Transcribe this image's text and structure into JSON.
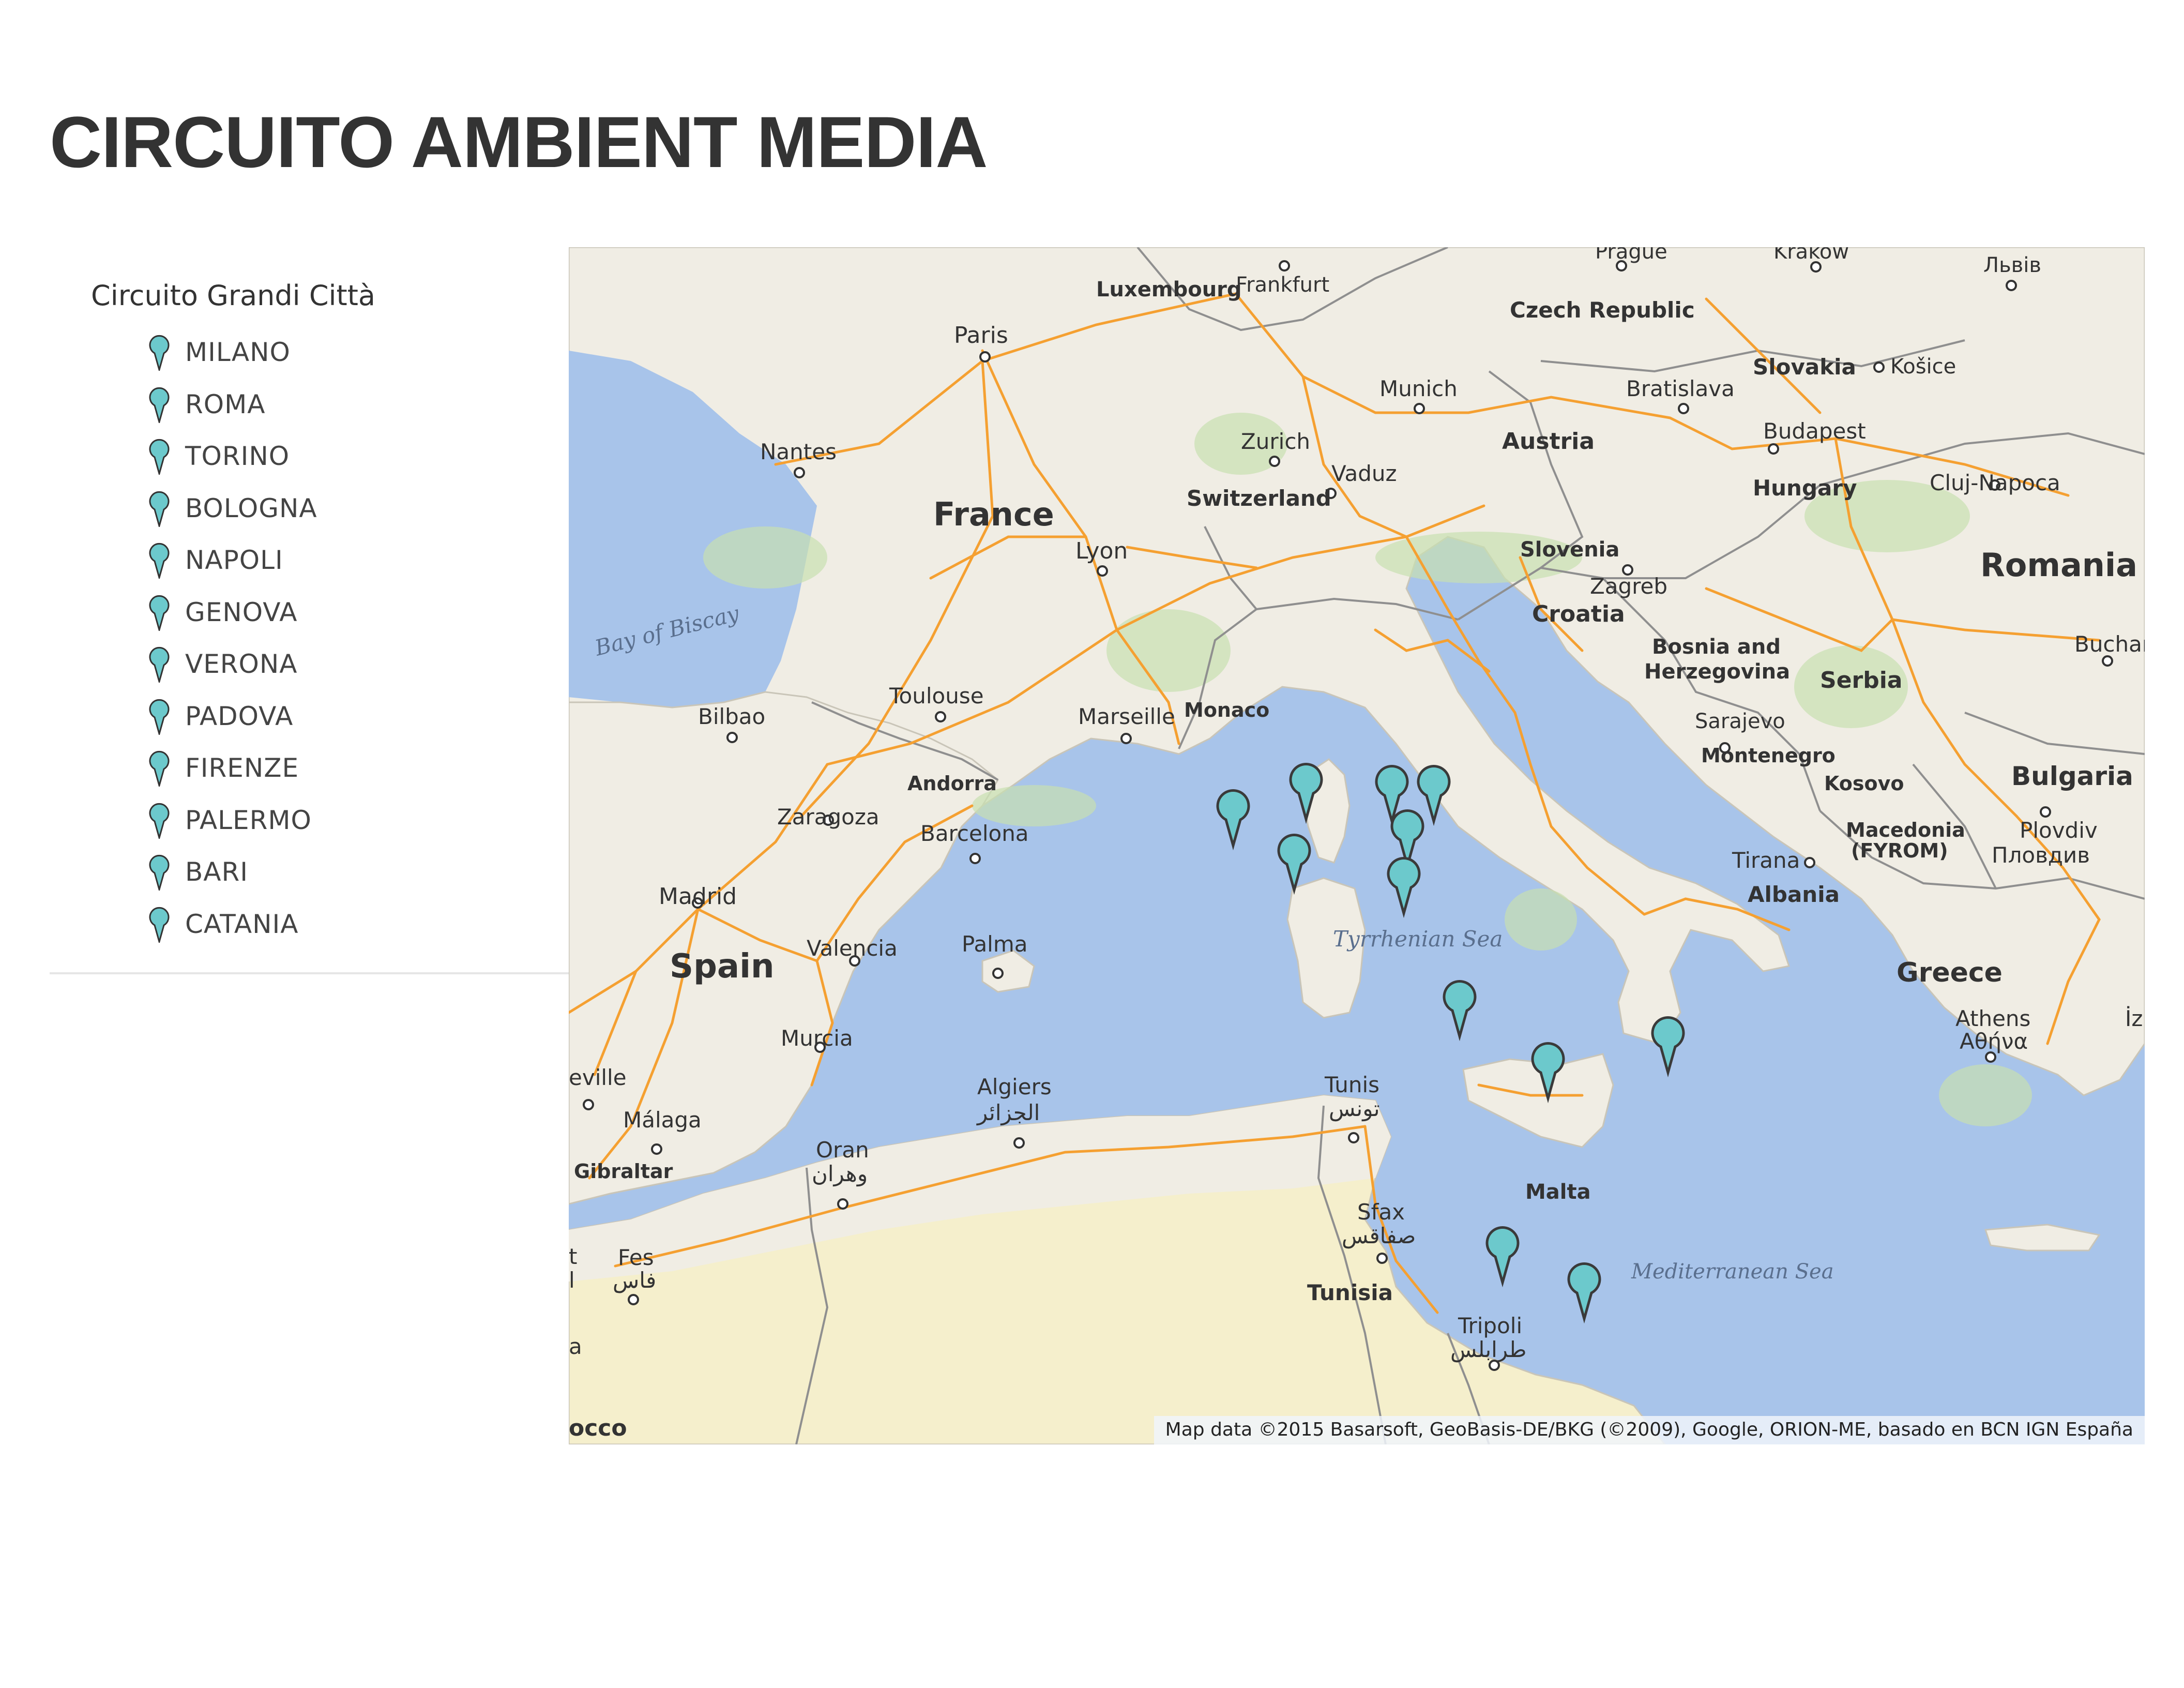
{
  "page": {
    "title": "CIRCUITO AMBIENT MEDIA"
  },
  "legend": {
    "title": "Circuito Grandi Città",
    "items": [
      {
        "label": "MILANO"
      },
      {
        "label": "ROMA"
      },
      {
        "label": "TORINO"
      },
      {
        "label": "BOLOGNA"
      },
      {
        "label": "NAPOLI"
      },
      {
        "label": "GENOVA"
      },
      {
        "label": "VERONA"
      },
      {
        "label": "PADOVA"
      },
      {
        "label": "FIRENZE"
      },
      {
        "label": "PALERMO"
      },
      {
        "label": "BARI"
      },
      {
        "label": "CATANIA"
      }
    ]
  },
  "map": {
    "attribution": "Map data ©2015 Basarsoft, GeoBasis-DE/BKG (©2009), Google, ORION-ME, basado en BCN IGN España",
    "colors": {
      "sea": "#a8c4ea",
      "land": "#f0ede4",
      "road": "#f5a031",
      "pin": "#6cc9cc",
      "pin_border": "#3a3a3a",
      "green": "#c8dfb0",
      "desert": "#f5efcc"
    },
    "labels": {
      "prague": "Prague",
      "krakow": "Kraków",
      "lviv": "Львів",
      "luxembourg": "Luxembourg",
      "frankfurt": "Frankfurt",
      "czech_republic": "Czech Republic",
      "paris": "Paris",
      "slovakia": "Slovakia",
      "kosice": "Košice",
      "munich": "Munich",
      "bratislava": "Bratislava",
      "nantes": "Nantes",
      "zurich": "Zurich",
      "austria": "Austria",
      "budapest": "Budapest",
      "vaduz": "Vaduz",
      "switzerland": "Switzerland",
      "hungary": "Hungary",
      "cluj_napoca": "Cluj-Napoca",
      "france": "France",
      "lyon": "Lyon",
      "slovenia": "Slovenia",
      "romania": "Romania",
      "zagreb": "Zagreb",
      "bay_of_biscay": "Bay of Biscay",
      "croatia": "Croatia",
      "bucharest": "Buchare",
      "bosnia_herzegovina": "Bosnia and",
      "bosnia_herzegovina_2": "Herzegovina",
      "serbia": "Serbia",
      "toulouse": "Toulouse",
      "bilbao": "Bilbao",
      "marseille": "Marseille",
      "monaco": "Monaco",
      "sarajevo": "Sarajevo",
      "montenegro": "Montenegro",
      "andorra": "Andorra",
      "kosovo": "Kosovo",
      "bulgaria": "Bulgaria",
      "zaragoza": "Zaragoza",
      "barcelona": "Barcelona",
      "macedonia": "Macedonia",
      "fyrom": "(FYROM)",
      "plovdiv": "Plovdiv",
      "plovdiv_bg": "Пловдив",
      "tirana": "Tirana",
      "madrid": "Madrid",
      "albania": "Albania",
      "tyrrhenian_sea": "Tyrrhenian Sea",
      "spain": "Spain",
      "valencia": "Valencia",
      "palma": "Palma",
      "greece": "Greece",
      "athens": "Athens",
      "athens_gr": "Αθήνα",
      "murcia": "Murcia",
      "seville": "eville",
      "algiers": "Algiers",
      "algiers_ar": "الجزائر",
      "tunis": "Tunis",
      "tunis_ar": "تونس",
      "malaga": "Málaga",
      "oran": "Oran",
      "oran_ar": "وهران",
      "gibraltar": "Gibraltar",
      "malta": "Malta",
      "sfax": "Sfax",
      "sfax_ar": "صفاقس",
      "fes": "Fes",
      "fes_ar": "فاس",
      "mediterranean_sea": "Mediterranean Sea",
      "tunisia": "Tunisia",
      "tripoli": "Tripoli",
      "tripoli_ar": "طرابلس",
      "morocco": "occo",
      "iz": "İz",
      "left_t": "t",
      "left_l": "l",
      "left_a": "a"
    }
  }
}
